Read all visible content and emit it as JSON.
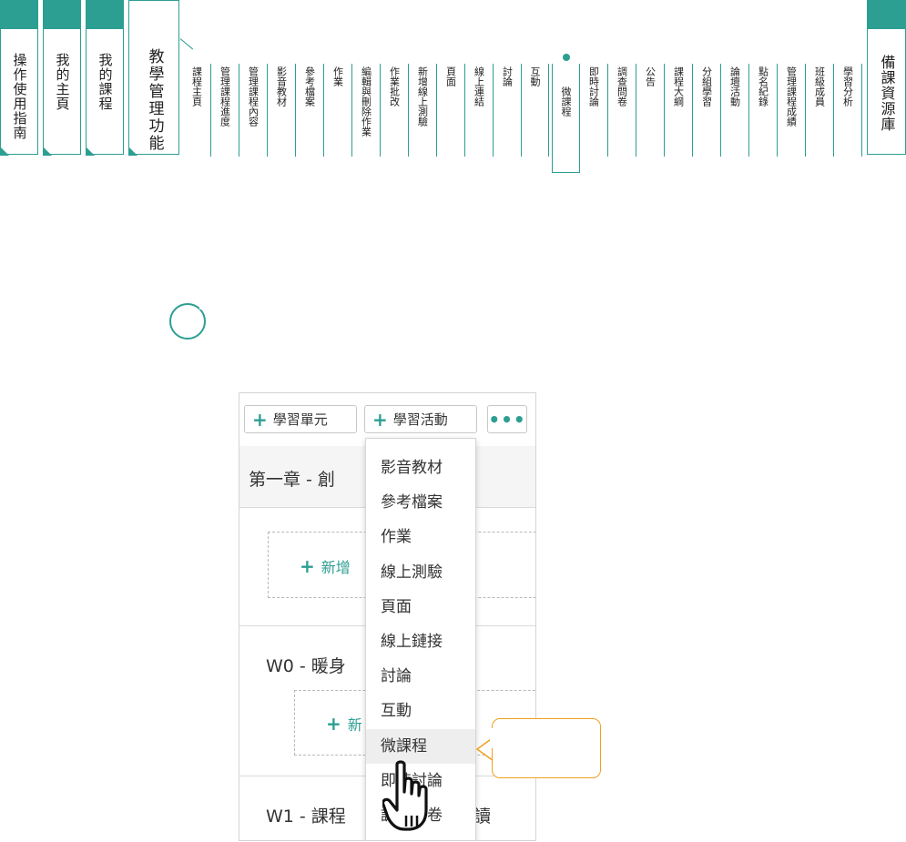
{
  "nav": {
    "main_tabs": [
      {
        "label": "操作使用指南"
      },
      {
        "label": "我的主頁"
      },
      {
        "label": "我的課程"
      },
      {
        "label": "教學管理功能"
      }
    ],
    "sub_tabs": [
      {
        "label": "課程主頁"
      },
      {
        "label": "管理課程進度"
      },
      {
        "label": "管理課程內容"
      },
      {
        "label": "影音教材"
      },
      {
        "label": "參考檔案"
      },
      {
        "label": "作業"
      },
      {
        "label": "編輯與刪除作業"
      },
      {
        "label": "作業批改"
      },
      {
        "label": "新增線上測驗"
      },
      {
        "label": "頁面"
      },
      {
        "label": "線上連結"
      },
      {
        "label": "討論"
      },
      {
        "label": "互動"
      },
      {
        "label": "微課程",
        "active": true
      },
      {
        "label": "即時討論"
      },
      {
        "label": "調查問卷"
      },
      {
        "label": "公告"
      },
      {
        "label": "課程大綱"
      },
      {
        "label": "分組學習"
      },
      {
        "label": "論壇活動"
      },
      {
        "label": "點名紀錄"
      },
      {
        "label": "管理課程成績"
      },
      {
        "label": "班級成員"
      },
      {
        "label": "學習分析"
      }
    ],
    "right_tab": {
      "label": "備課資源庫"
    }
  },
  "toolbar": {
    "add_unit": "學習單元",
    "add_activity": "學習活動",
    "more": "•••"
  },
  "sections": [
    {
      "title": "第一章 - 創",
      "add_label": "新增"
    },
    {
      "title": "W0 - 暖身",
      "add_label": "新"
    },
    {
      "title": "W1 - 課程",
      "suffix": "讀"
    }
  ],
  "dropdown": {
    "items": [
      {
        "label": "影音教材"
      },
      {
        "label": "參考檔案"
      },
      {
        "label": "作業"
      },
      {
        "label": "線上測驗"
      },
      {
        "label": "頁面"
      },
      {
        "label": "線上鏈接"
      },
      {
        "label": "討論"
      },
      {
        "label": "互動"
      },
      {
        "label": "微課程",
        "highlighted": true
      },
      {
        "label": "即時討論"
      },
      {
        "label": "調查問卷"
      }
    ]
  },
  "colors": {
    "accent": "#2d9e92",
    "callout_border": "#f0a020",
    "highlight_bg": "#eeeeee"
  },
  "icons": {
    "plus": "plus-icon",
    "more": "ellipsis-icon",
    "cursor": "hand-pointer-icon",
    "loading": "circle-loading-icon"
  }
}
